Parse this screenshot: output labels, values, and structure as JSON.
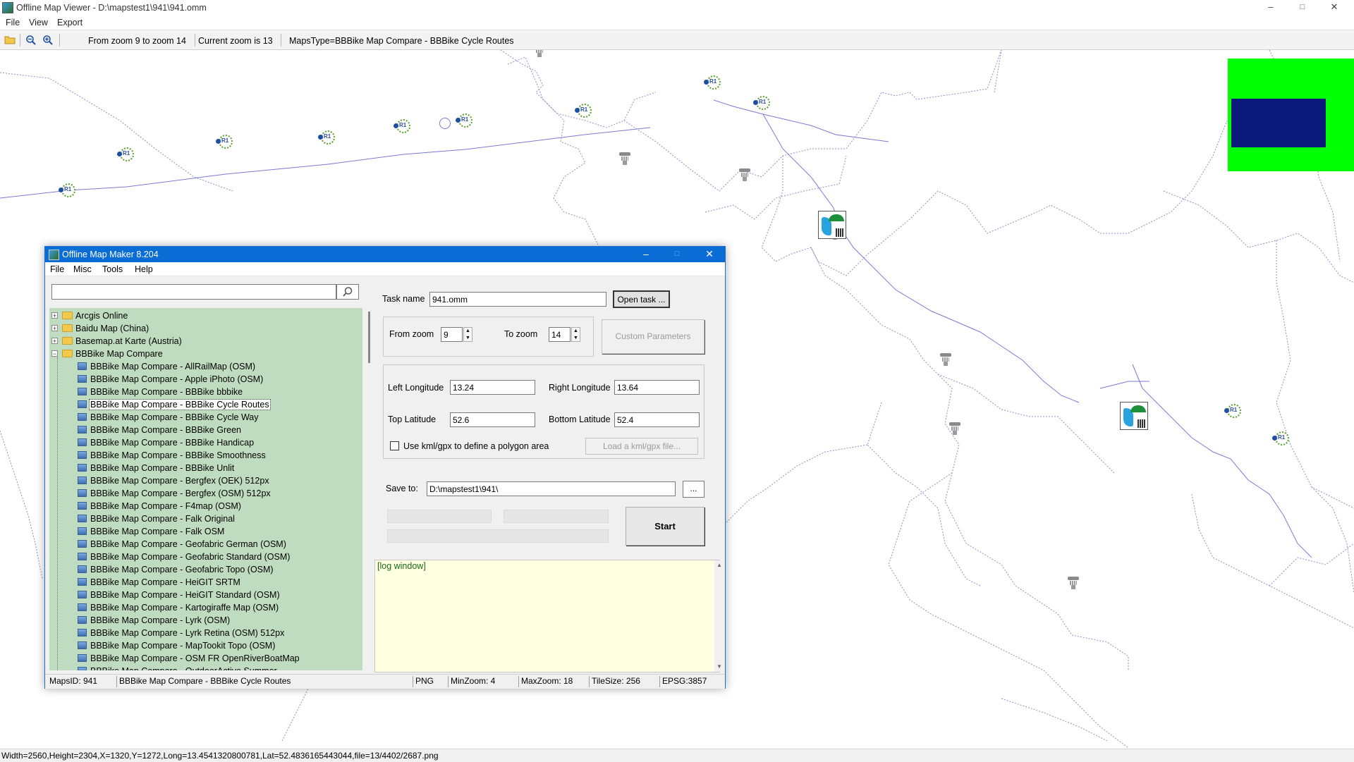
{
  "window": {
    "title": "Offline Map Viewer - D:\\mapstest1\\941\\941.omm",
    "controls": {
      "minimize": "–",
      "maximize": "□",
      "close": "✕"
    }
  },
  "menu": [
    "File",
    "View",
    "Export"
  ],
  "toolbar": {
    "zoom_range": "From zoom 9 to zoom 14",
    "current_zoom": "Current zoom is 13",
    "maps_type": "MapsType=BBBike Map Compare - BBBike Cycle Routes"
  },
  "map": {
    "route_marker_label": "R1",
    "minimap": {
      "outer_color": "#00ff00",
      "inner_color": "#0b1a7a"
    }
  },
  "status_bar": "Width=2560,Height=2304,X=1320,Y=1272,Long=13.4541320800781,Lat=52.4836165443044,file=13/4402/2687.png",
  "dialog": {
    "title": "Offline Map Maker 8.204",
    "menu": [
      "File",
      "Misc",
      "Tools",
      "Help"
    ],
    "search": {
      "value": "",
      "icon": "search-icon"
    },
    "tree": {
      "folders": [
        {
          "label": "Arcgis Online",
          "expanded": false
        },
        {
          "label": "Baidu Map (China)",
          "expanded": false
        },
        {
          "label": "Basemap.at Karte (Austria)",
          "expanded": false
        },
        {
          "label": "BBBike Map Compare",
          "expanded": true
        }
      ],
      "items": [
        "BBBike Map Compare - AllRailMap (OSM)",
        "BBBike Map Compare - Apple iPhoto (OSM)",
        "BBBike Map Compare - BBBike bbbike",
        "BBBike Map Compare - BBBike Cycle Routes",
        "BBBike Map Compare - BBBike Cycle Way",
        "BBBike Map Compare - BBBike Green",
        "BBBike Map Compare - BBBike Handicap",
        "BBBike Map Compare - BBBike Smoothness",
        "BBBike Map Compare - BBBike Unlit",
        "BBBike Map Compare - Bergfex (OEK) 512px",
        "BBBike Map Compare - Bergfex (OSM) 512px",
        "BBBike Map Compare - F4map (OSM)",
        "BBBike Map Compare - Falk Original",
        "BBBike Map Compare - Falk OSM",
        "BBBike Map Compare - Geofabric German (OSM)",
        "BBBike Map Compare - Geofabric Standard (OSM)",
        "BBBike Map Compare - Geofabric Topo (OSM)",
        "BBBike Map Compare - HeiGIT SRTM",
        "BBBike Map Compare - HeiGIT Standard (OSM)",
        "BBBike Map Compare - Kartogiraffe Map (OSM)",
        "BBBike Map Compare - Lyrk (OSM)",
        "BBBike Map Compare - Lyrk Retina (OSM) 512px",
        "BBBike Map Compare - MapTookit Topo (OSM)",
        "BBBike Map Compare - OSM FR OpenRiverBoatMap",
        "BBBike Map Compare - OutdoorActive Summer"
      ],
      "selected_index": 3
    },
    "task_name": {
      "label": "Task name",
      "value": "941.omm"
    },
    "open_task": "Open task ...",
    "from_zoom": {
      "label": "From zoom",
      "value": "9"
    },
    "to_zoom": {
      "label": "To zoom",
      "value": "14"
    },
    "custom_params": "Custom Parameters",
    "left_longitude": {
      "label": "Left Longitude",
      "value": "13.24"
    },
    "right_longitude": {
      "label": "Right Longitude",
      "value": "13.64"
    },
    "top_latitude": {
      "label": "Top Latitude",
      "value": "52.6"
    },
    "bottom_latitude": {
      "label": "Bottom Latitude",
      "value": "52.4"
    },
    "kml_checkbox": {
      "label": "Use kml/gpx to define a polygon area",
      "checked": false
    },
    "load_kml": "Load a kml/gpx file...",
    "save_to": {
      "label": "Save to:",
      "value": "D:\\mapstest1\\941\\"
    },
    "browse": "...",
    "start": "Start",
    "log": "[log window]",
    "status": {
      "maps_id": "MapsID: 941",
      "map_name": "BBBike Map Compare - BBBike Cycle Routes",
      "format": "PNG",
      "min_zoom": "MinZoom: 4",
      "max_zoom": "MaxZoom: 18",
      "tile_size": "TileSize: 256",
      "epsg": "EPSG:3857"
    }
  }
}
